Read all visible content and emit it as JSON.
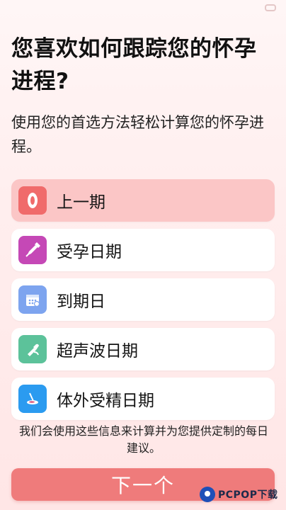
{
  "header": {
    "title": "您喜欢如何跟踪您的怀孕进程?",
    "subtitle": "使用您的首选方法轻松计算您的怀孕进程。"
  },
  "options": [
    {
      "label": "上一期",
      "icon": "pad-icon",
      "icon_color": "#f06b6b",
      "selected": true
    },
    {
      "label": "受孕日期",
      "icon": "pen-icon",
      "icon_color": "#c548b6",
      "selected": false
    },
    {
      "label": "到期日",
      "icon": "calendar-icon",
      "icon_color": "#7da4ef",
      "selected": false
    },
    {
      "label": "超声波日期",
      "icon": "ultrasound-icon",
      "icon_color": "#5cc29a",
      "selected": false
    },
    {
      "label": "体外受精日期",
      "icon": "ivf-icon",
      "icon_color": "#2b9bf0",
      "selected": false
    }
  ],
  "info_text": "我们会使用这些信息来计算并为您提供定制的每日建议。",
  "next_button": {
    "label": "下一个"
  },
  "watermark": {
    "text": "PCPOP下载"
  },
  "colors": {
    "accent": "#ef7b7b",
    "selected_bg": "#fbc6c6"
  }
}
